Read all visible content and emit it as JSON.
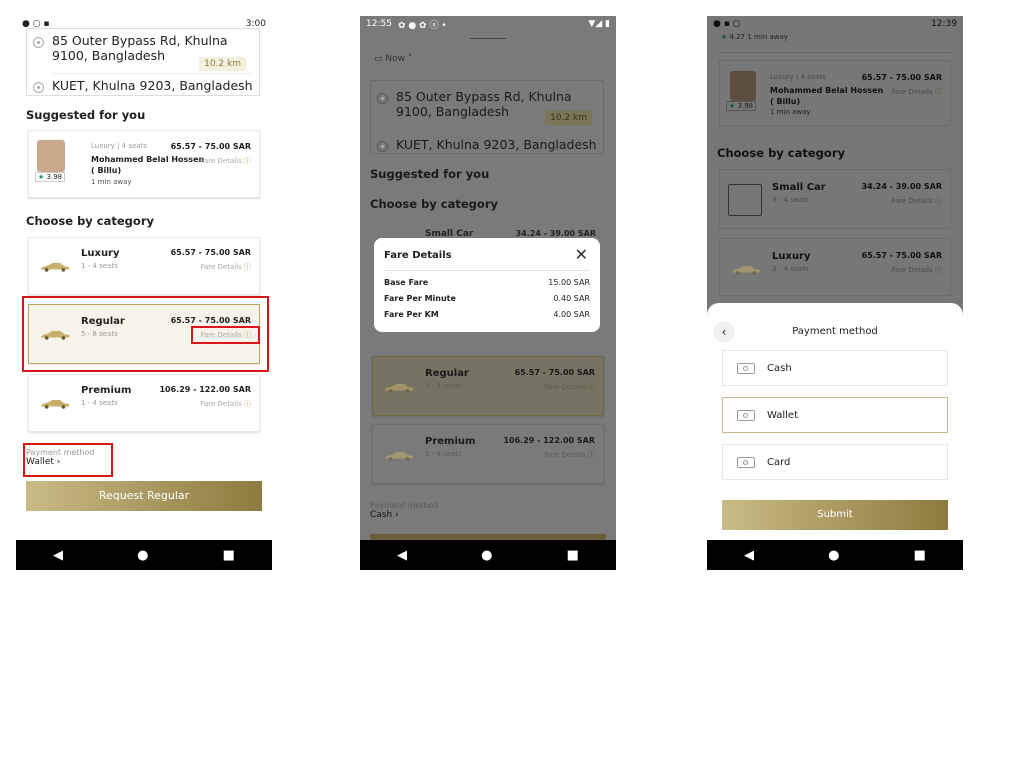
{
  "screen1": {
    "status_time": "3:00",
    "pickup": "85 Outer Bypass Rd, Khulna 9100, Bangladesh",
    "distance": "10.2 km",
    "dropoff": "KUET, Khulna 9203, Bangladesh",
    "suggested_title": "Suggested for you",
    "driver": {
      "category": "Luxury",
      "seats": "4 seats",
      "price": "65.57 - 75.00 SAR",
      "name": "Mohammed Belal Hossen",
      "nick": "( Billu)",
      "eta": "1 min away",
      "rating": "3.98",
      "fare_link": "Fare Details"
    },
    "category_title": "Choose by category",
    "categories": [
      {
        "name": "Luxury",
        "seats": "1 - 4 seats",
        "price": "65.57 - 75.00 SAR",
        "fare_link": "Fare Details"
      },
      {
        "name": "Regular",
        "seats": "5 - 8 seats",
        "price": "65.57 - 75.00 SAR",
        "fare_link": "Fare Details"
      },
      {
        "name": "Premium",
        "seats": "1 - 4 seats",
        "price": "106.29 - 122.00 SAR",
        "fare_link": "Fare Details"
      }
    ],
    "payment_label": "Payment method",
    "payment_value": "Wallet",
    "request_button": "Request Regular"
  },
  "screen2": {
    "status_time": "12:55",
    "time_select": "Now",
    "pickup": "85 Outer Bypass Rd, Khulna 9100, Bangladesh",
    "distance": "10.2 km",
    "dropoff": "KUET, Khulna 9203, Bangladesh",
    "suggested_title": "Suggested for you",
    "category_title": "Choose by category",
    "partial_category": {
      "name": "Small Car",
      "price": "34.24 - 39.00 SAR"
    },
    "fare_dialog": {
      "title": "Fare Details",
      "rows": [
        {
          "label": "Base Fare",
          "value": "15.00 SAR"
        },
        {
          "label": "Fare Per Minute",
          "value": "0.40 SAR"
        },
        {
          "label": "Fare Per KM",
          "value": "4.00 SAR"
        }
      ]
    },
    "categories": [
      {
        "name": "Regular",
        "seats": "5 - 8 seats",
        "price": "65.57 - 75.00 SAR",
        "fare_link": "Fare Details"
      },
      {
        "name": "Premium",
        "seats": "1 - 4 seats",
        "price": "106.29 - 122.00 SAR",
        "fare_link": "Fare Details"
      }
    ],
    "payment_label": "Payment method",
    "payment_value": "Cash"
  },
  "screen3": {
    "status_time": "12:39",
    "top_rating": "4.27",
    "top_eta": "1 min away",
    "driver": {
      "category": "Luxury",
      "seats": "4 seats",
      "price": "65.57 - 75.00 SAR",
      "name": "Mohammed Belal Hossen",
      "nick": "( Billu)",
      "eta": "1 min away",
      "rating": "3.98",
      "fare_link": "Fare Details"
    },
    "category_title": "Choose by category",
    "categories": [
      {
        "name": "Small Car",
        "seats": "3 - 4 seats",
        "price": "34.24 - 39.00 SAR",
        "fare_link": "Fare Details"
      },
      {
        "name": "Luxury",
        "seats": "3 - 4 seats",
        "price": "65.57 - 75.00 SAR",
        "fare_link": "Fare Details"
      }
    ],
    "sheet_title": "Payment method",
    "options": [
      "Cash",
      "Wallet",
      "Card"
    ],
    "selected_option": "Wallet",
    "submit": "Submit"
  },
  "colors": {
    "gold": "#b39a4c",
    "highlight": "#d81818",
    "navbar": "#000000"
  },
  "icons": [
    "back-icon",
    "home-icon",
    "recents-icon",
    "info-icon",
    "close-icon",
    "cash-icon",
    "car-icon",
    "location-pin-icon",
    "calendar-icon",
    "star-icon",
    "chevron-right-icon",
    "chevron-left-icon",
    "image-placeholder-icon"
  ]
}
